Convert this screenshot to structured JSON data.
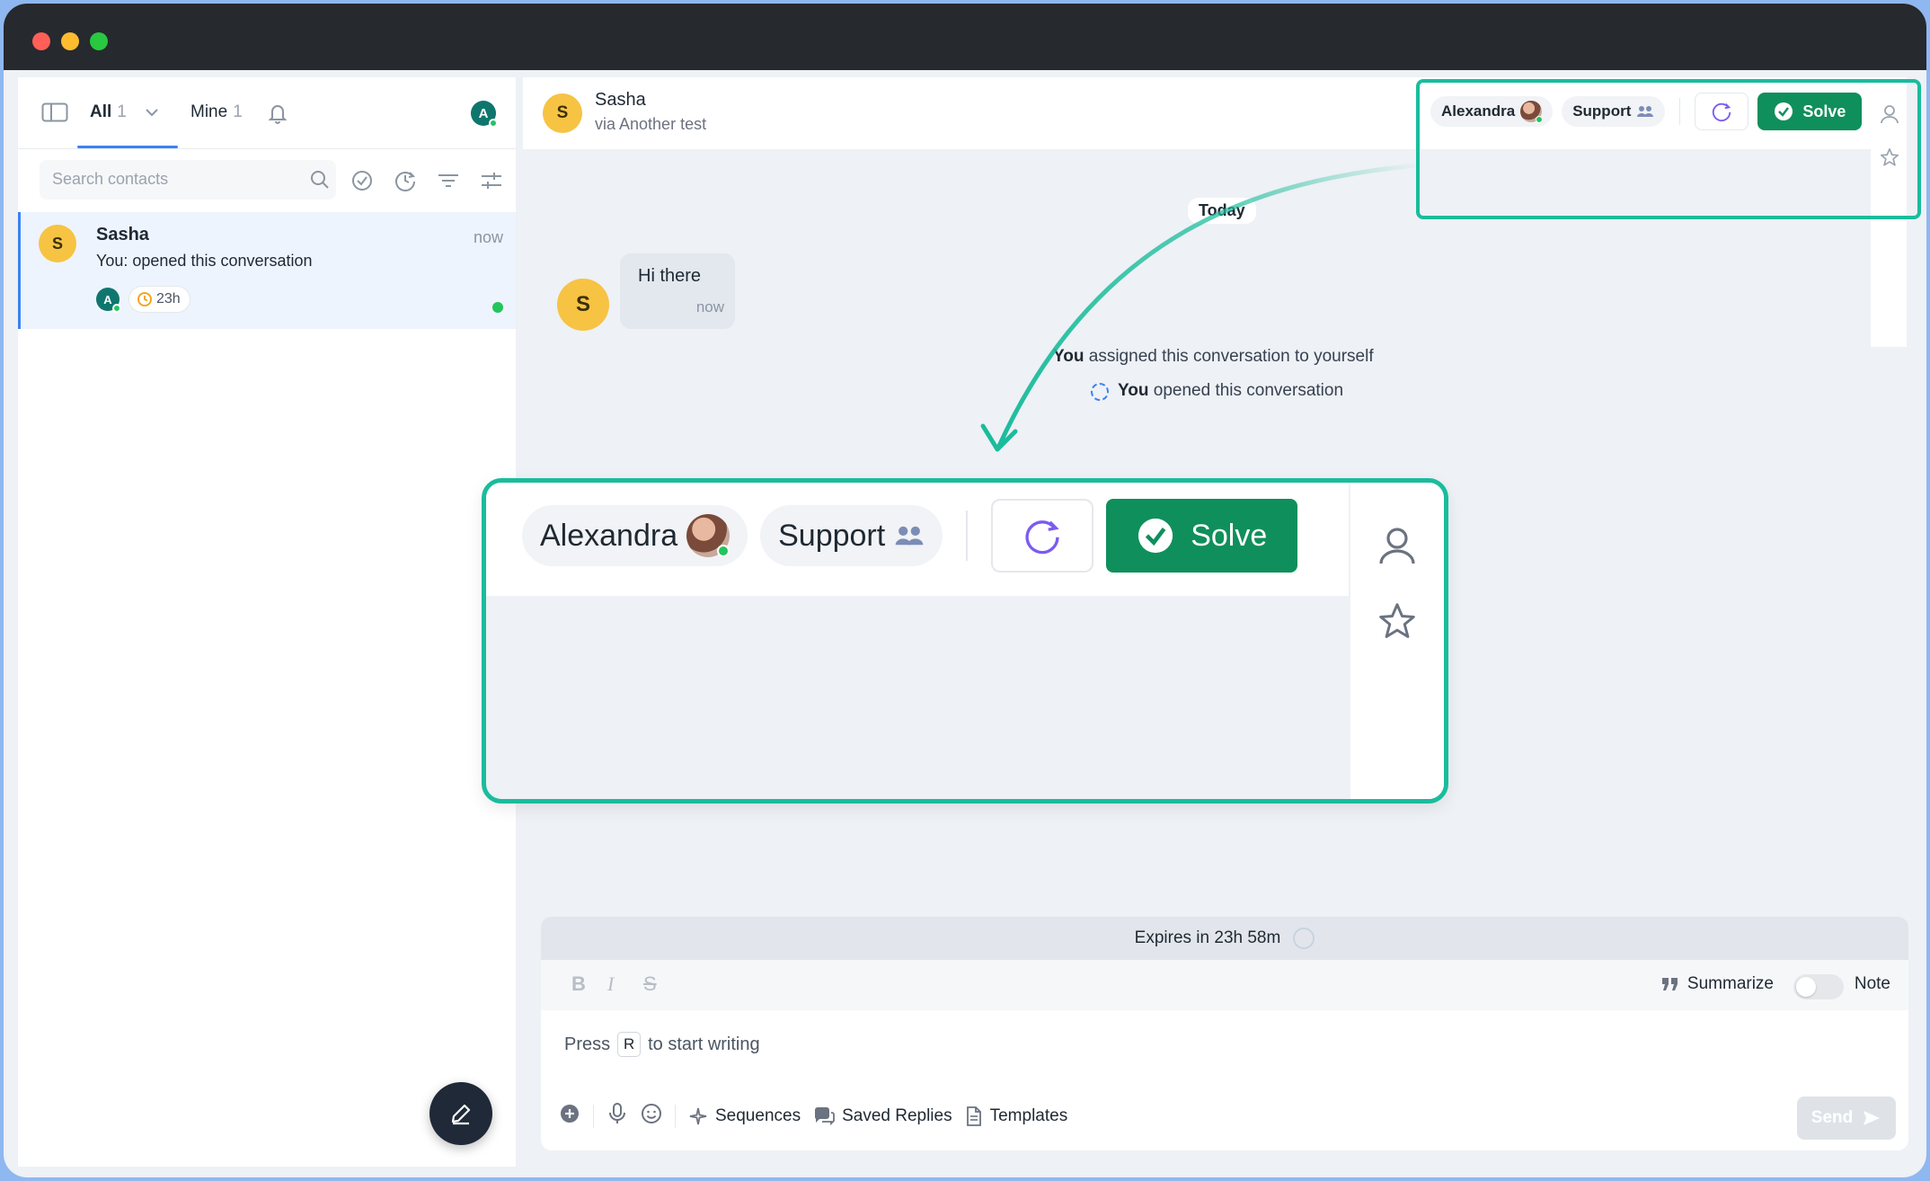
{
  "sidebar": {
    "tabs": [
      {
        "label": "All",
        "count": "1"
      },
      {
        "label": "Mine",
        "count": "1"
      }
    ],
    "user_initial": "A",
    "search": {
      "placeholder": "Search contacts"
    },
    "conversations": [
      {
        "initial": "S",
        "name": "Sasha",
        "time": "now",
        "preview": "You: opened this conversation",
        "assignee_initial": "A",
        "timer": "23h"
      }
    ]
  },
  "header": {
    "initial": "S",
    "name": "Sasha",
    "subtitle": "via Another test",
    "assignee": "Alexandra",
    "team": "Support",
    "solve_label": "Solve"
  },
  "zoom": {
    "assignee": "Alexandra",
    "team": "Support",
    "solve_label": "Solve"
  },
  "thread": {
    "date_divider": "Today",
    "message": {
      "initial": "S",
      "text": "Hi there",
      "time": "now"
    },
    "events": [
      {
        "actor": "You",
        "text": "assigned this conversation to yourself"
      },
      {
        "actor": "You",
        "text": "opened this conversation"
      }
    ]
  },
  "composer": {
    "expires": "Expires in 23h 58m",
    "format": {
      "bold": "B",
      "italic": "I",
      "strike": "S"
    },
    "summarize_label": "Summarize",
    "note_label": "Note",
    "note_enabled": false,
    "press_prefix": "Press",
    "press_key": "R",
    "press_suffix": "to start writing",
    "tools": [
      "Sequences",
      "Saved Replies",
      "Templates"
    ],
    "send_label": "Send"
  },
  "colors": {
    "accent": "#1abc9c",
    "solve": "#0f8f5b",
    "link": "#3b82f6",
    "avatar_s": "#f6c343",
    "avatar_a": "#0f766e"
  }
}
